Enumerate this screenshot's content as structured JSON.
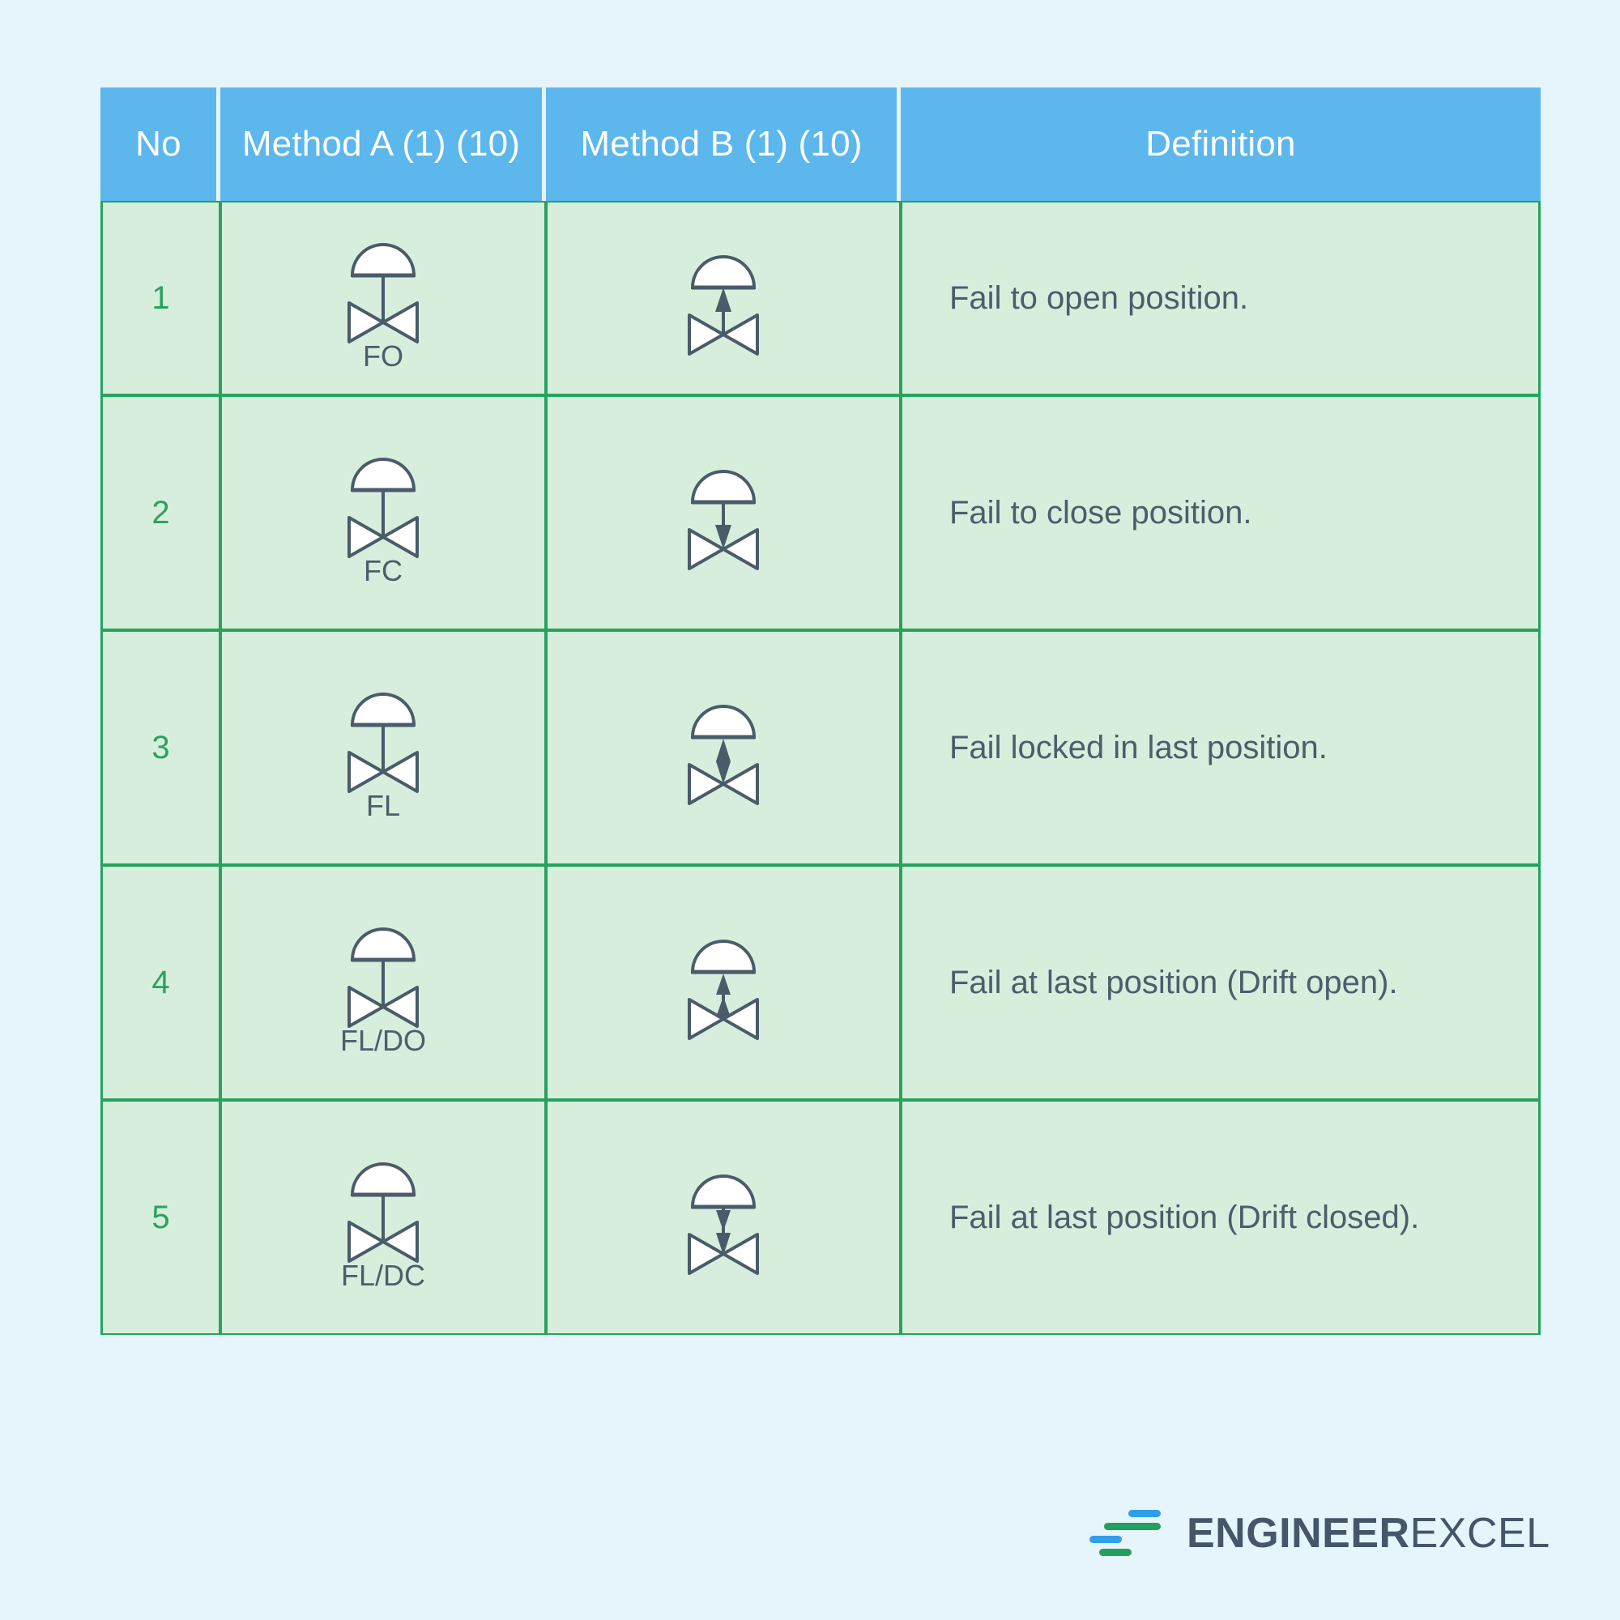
{
  "page": {
    "background_color": "#e6f4fc"
  },
  "table": {
    "header_bg": "#5cb7ec",
    "header_text_color": "#ffffff",
    "cell_bg": "#d8eedd",
    "border_color": "#25a35c",
    "number_color": "#2aa35e",
    "text_color": "#4d5d6c",
    "symbol_color": "#4a5b6a",
    "columns": [
      {
        "key": "no",
        "label": "No"
      },
      {
        "key": "ma",
        "label": "Method A (1) (10)"
      },
      {
        "key": "mb",
        "label": "Method B (1) (10)"
      },
      {
        "key": "def",
        "label": "Definition"
      }
    ],
    "rows": [
      {
        "no": "1",
        "method_a_label": "FO",
        "method_a_symbol": "diaphragm-valve-plain-stem",
        "method_b_symbol": "diaphragm-valve-arrow-up",
        "definition": "Fail to open position."
      },
      {
        "no": "2",
        "method_a_label": "FC",
        "method_a_symbol": "diaphragm-valve-plain-stem",
        "method_b_symbol": "diaphragm-valve-arrow-down",
        "definition": "Fail to close position."
      },
      {
        "no": "3",
        "method_a_label": "FL",
        "method_a_symbol": "diaphragm-valve-plain-stem",
        "method_b_symbol": "diaphragm-valve-arrow-double-ended",
        "definition": "Fail locked in last position."
      },
      {
        "no": "4",
        "method_a_label": "FL/DO",
        "method_a_symbol": "diaphragm-valve-plain-stem",
        "method_b_symbol": "diaphragm-valve-arrow-double-up",
        "definition": "Fail at last position (Drift open)."
      },
      {
        "no": "5",
        "method_a_label": "FL/DC",
        "method_a_symbol": "diaphragm-valve-plain-stem",
        "method_b_symbol": "diaphragm-valve-arrow-double-down",
        "definition": "Fail at last position (Drift closed)."
      }
    ]
  },
  "logo": {
    "name_strong": "ENGINEER",
    "name_light": "EXCEL",
    "mark_color_blue": "#2e9fe8",
    "mark_color_green": "#22a05c",
    "text_color": "#46566a"
  }
}
